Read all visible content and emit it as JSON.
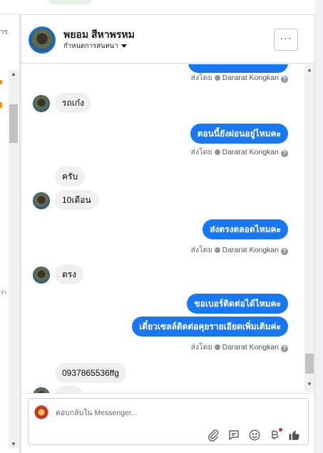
{
  "left_panel": {
    "fragments": [
      "าร",
      "ว่า"
    ]
  },
  "conversation": {
    "name": "พยอม สีหาพรหม",
    "subtitle": "กำหนดการสนทนา",
    "more_label": "···"
  },
  "messages": {
    "sent_by_label": "ส่งโดย",
    "sender_name": "Dararat Kongkan",
    "help_glyph": "?",
    "m1": "รถเก๋ง",
    "m2": "ตอนนี้ยังผ่อนอยู่ไหมคะ",
    "m3": "ครับ",
    "m4": "10เดือน",
    "m5": "ส่งตรงตลอดไหมคะ",
    "m6": "ตรง",
    "m7": "ขอเบอร์ติดต่อได้ไหมคะ",
    "m8": "เดี๋ยวเซลล์ติดต่อคุยรายเอียดเพิ่มเติมค่ะ",
    "m9": "0937865536ffg"
  },
  "composer": {
    "placeholder": "ตอบกลับใน Messenger..."
  },
  "colors": {
    "accent": "#1877f2",
    "incoming_bubble": "#f0f0f0",
    "notification": "#e41e3f"
  },
  "icons": [
    "chevron-up-icon",
    "chevron-down-icon",
    "attach-icon",
    "saved-reply-icon",
    "emoji-icon",
    "currency-icon",
    "like-icon",
    "help-icon",
    "check-icon"
  ]
}
